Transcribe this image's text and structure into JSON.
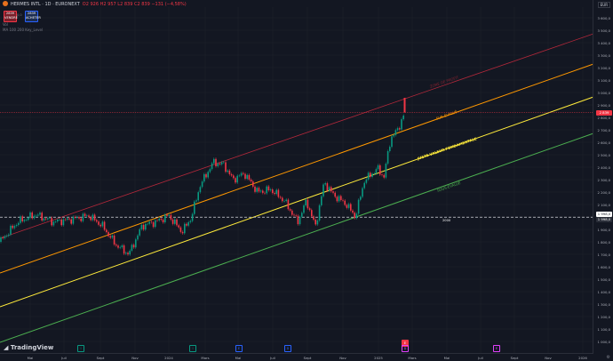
{
  "header": {
    "symbol": "HERMES INTL · 1D · EURONEXT",
    "ohlc": "O2 926 H2 957 L2 839 C2 839 −131 (−4,58%)",
    "sell_price": "2839",
    "sell_label": "VENDRE",
    "spread": "0,0",
    "buy_price": "2839",
    "buy_label": "ACHETER",
    "vol_label": "Vol",
    "ma_label": "MA 100 200 Key_Level"
  },
  "currency": "EUR",
  "y_axis": {
    "ticks": [
      "3 600,0",
      "3 500,0",
      "3 400,0",
      "3 300,0",
      "3 200,0",
      "3 100,0",
      "3 000,0",
      "2 900,0",
      "2 800,0",
      "2 700,0",
      "2 600,0",
      "2 500,0",
      "2 400,0",
      "2 300,0",
      "2 200,0",
      "2 100,0",
      "2 000,0",
      "1 900,0",
      "1 800,0",
      "1 700,0",
      "1 600,0",
      "1 500,0",
      "1 400,0",
      "1 300,0",
      "1 200,0",
      "1 100,0",
      "1 000,0"
    ],
    "current_price": "2 839",
    "level_price_a": "1 998,0",
    "level_price_b": "1 998,0"
  },
  "x_axis": {
    "ticks": [
      "Mai",
      "Juil",
      "Sept",
      "Nov",
      "2024",
      "Mars",
      "Mai",
      "Juil",
      "Sept",
      "Nov",
      "2025",
      "Mars",
      "Mai",
      "Juil",
      "Sept",
      "Nov",
      "2026"
    ]
  },
  "channels": {
    "upper_label": "ZONE DE PROFIT",
    "over_label": "SUR-ÉVALUÉ",
    "fair_label": "JUSTE VALEUR FONDAMENTALE",
    "under_label": "SOUS-ÉVALUÉ"
  },
  "level_label": "2000",
  "branding": "TradingView",
  "colors": {
    "background": "#131722",
    "red_channel": "#b2283a",
    "orange_channel": "#ff9800",
    "yellow_channel": "#ffeb3b",
    "green_channel": "#4caf50",
    "candle_up": "#089981",
    "candle_down": "#f23645"
  },
  "events": [
    "I",
    "I",
    "E",
    "D",
    "E",
    "D",
    "E"
  ]
}
